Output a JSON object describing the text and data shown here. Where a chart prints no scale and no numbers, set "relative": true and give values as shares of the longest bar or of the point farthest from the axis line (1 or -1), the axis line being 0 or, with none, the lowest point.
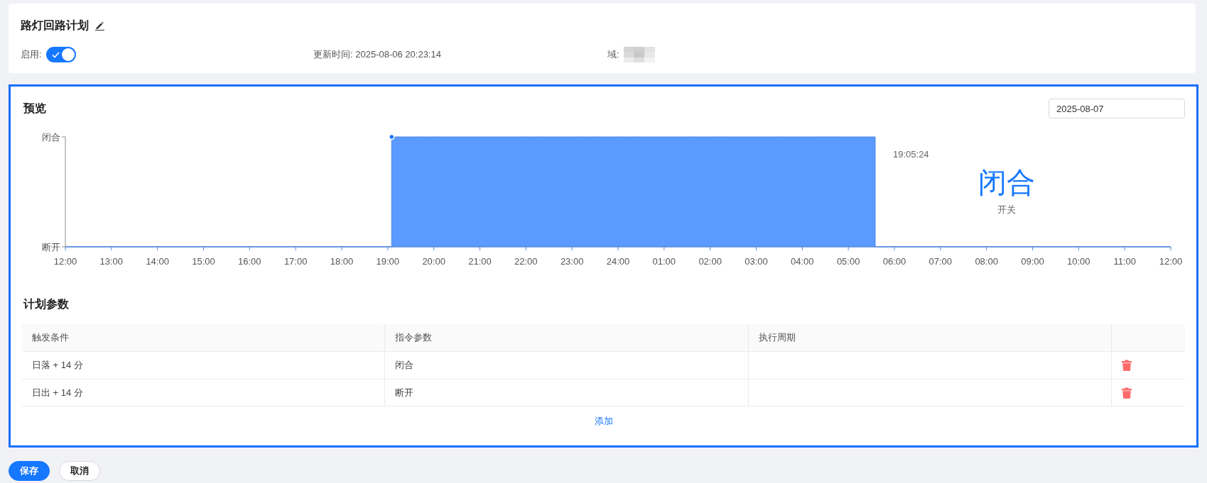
{
  "header": {
    "title": "路灯回路计划",
    "enabled_label": "启用:",
    "enabled": true,
    "updated": "更新时间: 2025-08-06 20:23:14",
    "domain_label": "域:"
  },
  "preview": {
    "title": "预览",
    "date": "2025-08-07",
    "state_labels": [
      "闭合",
      "断开"
    ],
    "chart_data": {
      "type": "area",
      "relative": true,
      "categories": [
        "12:00",
        null,
        null,
        null,
        null,
        null,
        null,
        null,
        null,
        null,
        null,
        null,
        "13:00",
        null,
        null,
        null,
        null,
        null,
        null,
        null,
        null,
        null,
        null,
        null,
        "14:00",
        null,
        null,
        null,
        null,
        null,
        null,
        null,
        null,
        null,
        null,
        null,
        "15:00",
        null,
        null,
        null,
        null,
        null,
        null,
        null,
        null,
        null,
        null,
        null,
        "16:00",
        null,
        null,
        null,
        null,
        null,
        null,
        null,
        null,
        null,
        null,
        null,
        "17:00",
        null,
        null,
        null,
        null,
        null,
        null,
        null,
        null,
        null,
        null,
        null,
        "18:00",
        null,
        null,
        null,
        null,
        null,
        null,
        null,
        null,
        null,
        null,
        null,
        "19:00",
        null,
        null,
        null,
        null,
        null,
        null,
        null,
        null,
        null,
        null,
        null,
        "20:00",
        null,
        null,
        null,
        null,
        null,
        null,
        null,
        null,
        null,
        null,
        null,
        "21:00",
        null,
        null,
        null,
        null,
        null,
        null,
        null,
        null,
        null,
        null,
        null,
        "22:00",
        null,
        null,
        null,
        null,
        null,
        null,
        null,
        null,
        null,
        null,
        null,
        "23:00",
        null,
        null,
        null,
        null,
        null,
        null,
        null,
        null,
        null,
        null,
        null,
        "24:00",
        null,
        null,
        null,
        null,
        null,
        null,
        null,
        null,
        null,
        null,
        null,
        "01:00",
        null,
        null,
        null,
        null,
        null,
        null,
        null,
        null,
        null,
        null,
        null,
        "02:00",
        null,
        null,
        null,
        null,
        null,
        null,
        null,
        null,
        null,
        null,
        null,
        "03:00",
        null,
        null,
        null,
        null,
        null,
        null,
        null,
        null,
        null,
        null,
        null,
        "04:00",
        null,
        null,
        null,
        null,
        null,
        null,
        null,
        null,
        null,
        null,
        null,
        "05:00",
        null,
        null,
        null,
        null,
        null,
        null,
        null,
        null,
        null,
        null,
        null,
        "06:00",
        null,
        null,
        null,
        null,
        null,
        null,
        null,
        null,
        null,
        null,
        null,
        "07:00",
        null,
        null,
        null,
        null,
        null,
        null,
        null,
        null,
        null,
        null,
        null,
        "08:00",
        null,
        null,
        null,
        null,
        null,
        null,
        null,
        null,
        null,
        null,
        null,
        "09:00",
        null,
        null,
        null,
        null,
        null,
        null,
        null,
        null,
        null,
        null,
        null,
        "10:00",
        null,
        null,
        null,
        null,
        null,
        null,
        null,
        null,
        null,
        null,
        null,
        "11:00",
        null,
        null,
        null,
        null,
        null,
        null,
        null,
        null,
        null,
        null,
        null,
        "12:00"
      ],
      "series": [
        {
          "color": "#5b9aff",
          "values": [
            0,
            0,
            0,
            0,
            0,
            0,
            0,
            0,
            0,
            0,
            0,
            0,
            0,
            0,
            0,
            0,
            0,
            0,
            0,
            0,
            0,
            0,
            0,
            0,
            0,
            0,
            0,
            0,
            0,
            0,
            0,
            0,
            0,
            0,
            0,
            0,
            0,
            0,
            0,
            0,
            0,
            0,
            0,
            0,
            0,
            0,
            0,
            0,
            0,
            0,
            0,
            0,
            0,
            0,
            0,
            0,
            0,
            0,
            0,
            0,
            0,
            0,
            0,
            0,
            0,
            0,
            0,
            0,
            0,
            0,
            0,
            0,
            0,
            0,
            0,
            0,
            0,
            0,
            0,
            0,
            0,
            0,
            0,
            0,
            0,
            1,
            1,
            1,
            1,
            1,
            1,
            1,
            1,
            1,
            1,
            1,
            1,
            1,
            1,
            1,
            1,
            1,
            1,
            1,
            1,
            1,
            1,
            1,
            1,
            1,
            1,
            1,
            1,
            1,
            1,
            1,
            1,
            1,
            1,
            1,
            1,
            1,
            1,
            1,
            1,
            1,
            1,
            1,
            1,
            1,
            1,
            1,
            1,
            1,
            1,
            1,
            1,
            1,
            1,
            1,
            1,
            1,
            1,
            1,
            1,
            1,
            1,
            1,
            1,
            1,
            1,
            1,
            1,
            1,
            1,
            1,
            1,
            1,
            1,
            1,
            1,
            1,
            1,
            1,
            1,
            1,
            1,
            1,
            1,
            1,
            1,
            1,
            1,
            1,
            1,
            1,
            1,
            1,
            1,
            1,
            1,
            1,
            1,
            1,
            1,
            1,
            1,
            1,
            1,
            1,
            1,
            1,
            1,
            1,
            1,
            1,
            1,
            1,
            1,
            1,
            1,
            1,
            1,
            1,
            1,
            1,
            1,
            1,
            1,
            1,
            1,
            0,
            0,
            0,
            0,
            0,
            0,
            0,
            0,
            0,
            0,
            0,
            0,
            0,
            0,
            0,
            0,
            0,
            0,
            0,
            0,
            0,
            0,
            0,
            0,
            0,
            0,
            0,
            0,
            0,
            0,
            0,
            0,
            0,
            0,
            0,
            0,
            0,
            0,
            0,
            0,
            0,
            0,
            0,
            0,
            0,
            0,
            0,
            0,
            0,
            0,
            0,
            0,
            0,
            0,
            0,
            0,
            0,
            0,
            0,
            0,
            0,
            0,
            0,
            0,
            0,
            0,
            0,
            0,
            0,
            0,
            0,
            0,
            0,
            0,
            0,
            0,
            0,
            0
          ]
        }
      ],
      "ylim": [
        0,
        1
      ]
    },
    "readout": {
      "time": "19:05:24",
      "value": "闭合",
      "label": "开关"
    }
  },
  "plan": {
    "title": "计划参数",
    "columns": [
      "触发条件",
      "指令参数",
      "执行周期"
    ],
    "rows": [
      {
        "trigger": "日落 + 14 分",
        "command": "闭合"
      },
      {
        "trigger": "日出 + 14 分",
        "command": "断开"
      }
    ],
    "add_label": "添加"
  },
  "buttons": [
    {
      "label": "保存",
      "kind": "primary"
    },
    {
      "label": "取消",
      "kind": "secondary"
    }
  ]
}
